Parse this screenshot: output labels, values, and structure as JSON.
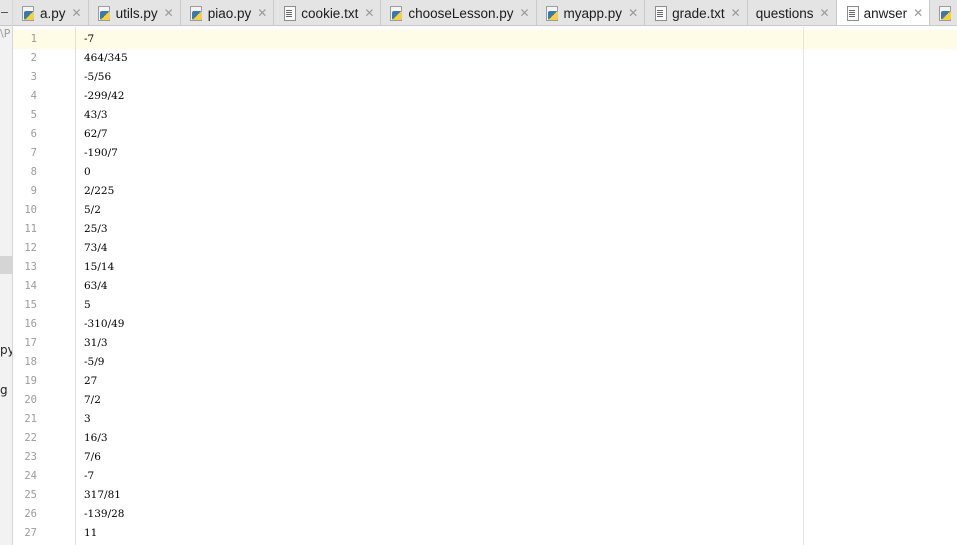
{
  "side_strip": {
    "path_fragment": "\\P",
    "py_fragment": "py",
    "g_fragment": "g"
  },
  "tabs": [
    {
      "label": "a.py",
      "icon": "python-file-icon",
      "active": false
    },
    {
      "label": "utils.py",
      "icon": "python-file-icon",
      "active": false
    },
    {
      "label": "piao.py",
      "icon": "python-file-icon",
      "active": false
    },
    {
      "label": "cookie.txt",
      "icon": "text-file-icon",
      "active": false
    },
    {
      "label": "chooseLesson.py",
      "icon": "python-file-icon",
      "active": false
    },
    {
      "label": "myapp.py",
      "icon": "python-file-icon",
      "active": false
    },
    {
      "label": "grade.txt",
      "icon": "text-file-icon",
      "active": false
    },
    {
      "label": "questions",
      "icon": "none",
      "active": false
    },
    {
      "label": "anwser",
      "icon": "text-file-icon",
      "active": true
    },
    {
      "label": "",
      "icon": "python-file-icon",
      "active": false
    }
  ],
  "close_glyph": "✕",
  "editor": {
    "current_line": 1,
    "lines": [
      "-7",
      "464/345",
      "-5/56",
      "-299/42",
      "43/3",
      "62/7",
      "-190/7",
      "0",
      "2/225",
      "5/2",
      "25/3",
      "73/4",
      "15/14",
      "63/4",
      "5",
      "-310/49",
      "31/3",
      "-5/9",
      "27",
      "7/2",
      "3",
      "16/3",
      "7/6",
      "-7",
      "317/81",
      "-139/28",
      "11"
    ]
  },
  "colors": {
    "current_line_bg": "#fefbe6",
    "gutter_text": "#9b9b9b",
    "tab_bar_bg": "#e4e4e4",
    "active_tab_bg": "#ffffff"
  }
}
